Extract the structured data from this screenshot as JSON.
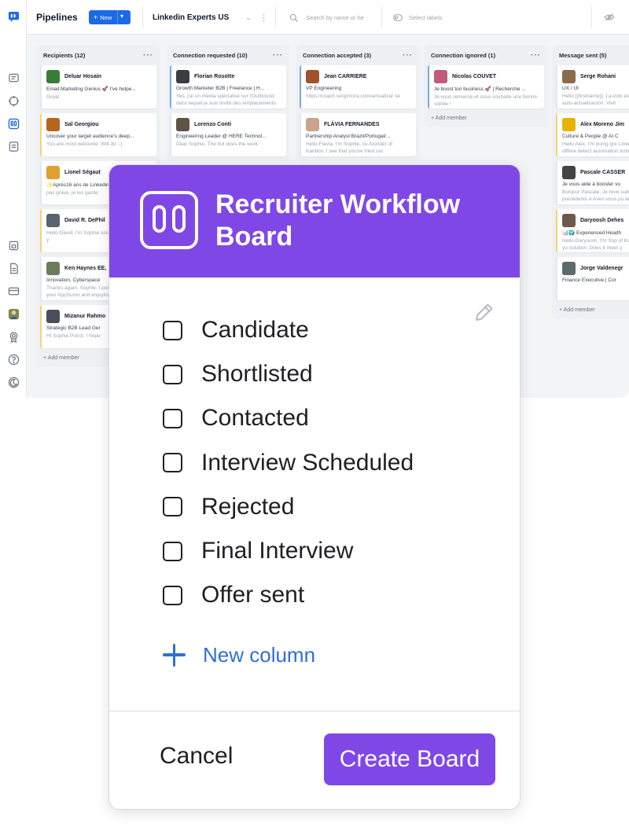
{
  "topbar": {
    "title": "Pipelines",
    "new_label": "New",
    "board_name": "Linkedin Experts US",
    "search_placeholder": "Search by name or he",
    "labels_placeholder": "Select labels"
  },
  "columns": [
    {
      "title": "Recipients (12)",
      "add": "+ Add member",
      "cards": [
        {
          "name": "Deluar Hosain",
          "headline": "Email Marketing Genius 🚀 I've helpe...",
          "msg": "Great",
          "color": "#3a7d3a"
        },
        {
          "name": "Sal Georgiou",
          "headline": "Uncover your target audience's deep...",
          "msg": "You are most welcome. Will do :-)",
          "color": "#b5651d"
        },
        {
          "name": "Lionel Ségaut",
          "headline": "✨Après16 ans de Linkedin",
          "msg": "pas grave, je les garde",
          "color": "#e0a030"
        },
        {
          "name": "David R. DePhil",
          "headline": "",
          "msg": "Hello David, I'm Sophie solution. Does it meet y",
          "color": "#5a6470"
        },
        {
          "name": "Ken Haynes EE,",
          "headline": "Innovation, Cyberspace",
          "msg": "Thanks again, Sophie. I purchased one of your AppSumo and enjoying",
          "color": "#6b7c5a"
        },
        {
          "name": "Mizanur Rahmo",
          "headline": "Strategic B2B Lead Ger",
          "msg": "Hi Sophie Poirot. I hope",
          "color": "#4a4f5a"
        }
      ]
    },
    {
      "title": "Connection requested (10)",
      "add": "",
      "cards": [
        {
          "name": "Florian Rosotte",
          "headline": "Growth Marketer B2B | Freelance | H...",
          "msg": "Yes, j'ai un média spécialisé sur l'Outbound dans lequel je suis invité des emplacements sponsors, peut de...",
          "color": "#3c3c44"
        },
        {
          "name": "Lorenzo Conti",
          "headline": "Engineering Leader @ HERE Technol...",
          "msg": "Dear Sophie, The bot does the work",
          "color": "#5d5347"
        }
      ]
    },
    {
      "title": "Connection accepted (3)",
      "add": "",
      "cards": [
        {
          "name": "Jean CARRIERE",
          "headline": "VP Engineering",
          "msg": "https://coach.sergimora.com/actualizar se",
          "color": "#a0522d"
        },
        {
          "name": "FLÁVIA FERNANDES",
          "headline": "Partnership Analyst Brazil/Portugal/...",
          "msg": "Hello Flavia, I'm Sophie, co-founder of Kanbox. I see that you've tried our",
          "color": "#c9a38a"
        }
      ]
    },
    {
      "title": "Connection ignored (1)",
      "add": "+ Add member",
      "cards": [
        {
          "name": "Nicolas COUVET",
          "headline": "Je boost ton business 🚀 | Recherche ...",
          "msg": "Je vous remercie et vous souhaite une bonne soirée !",
          "color": "#c25a7a"
        }
      ]
    },
    {
      "title": "Message sent (5)",
      "add": "+ Add member",
      "cards": [
        {
          "name": "Serge Rohani",
          "headline": "UX / UI",
          "msg": "Hello {{firstname}}, La vido es un constante auto-actualización. Vivir",
          "color": "#8a6a4a"
        },
        {
          "name": "Alex Moreno Jim",
          "headline": "Culture & People @ AI C",
          "msg": "Hello Alex, I'm doing gre Linkedin is using differe detect automation tools.",
          "color": "#e6b400"
        },
        {
          "name": "Pascale CASSER",
          "headline": "Je vous aide à booster vo",
          "msg": "Bonjour Pascale, Je reve suite à nos précédents é Avez-vous pu tester Kanb",
          "color": "#444"
        },
        {
          "name": "Daryoosh Dehes",
          "headline": "📊🌍 Experienced Headh",
          "msg": "Hello Daryoosh, I'm Sop of Kanbox. I see that yo solution. Does it meet y",
          "color": "#6d5a4d"
        },
        {
          "name": "Jorge Valdenegr",
          "headline": "Finance Executive | Cor",
          "msg": "",
          "color": "#5a6b6b"
        }
      ]
    }
  ],
  "modal": {
    "title": "Recruiter Workflow Board",
    "options": [
      "Candidate",
      "Shortlisted",
      "Contacted",
      "Interview Scheduled",
      "Rejected",
      "Final Interview",
      "Offer sent"
    ],
    "new_column": "New column",
    "cancel": "Cancel",
    "create": "Create Board",
    "accent": "#7f48e6",
    "link_color": "#2f6fd9"
  }
}
